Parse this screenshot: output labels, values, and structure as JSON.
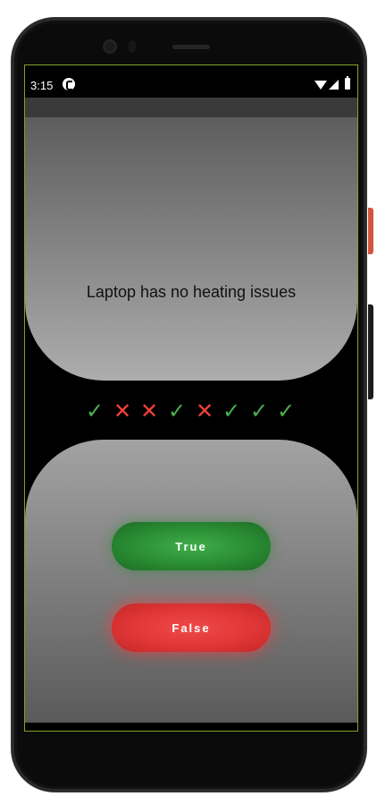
{
  "status_bar": {
    "time": "3:15"
  },
  "question": {
    "text": "Laptop has no heating issues"
  },
  "score_keeper": [
    "correct",
    "wrong",
    "wrong",
    "correct",
    "wrong",
    "correct",
    "correct",
    "correct"
  ],
  "score_glyphs": {
    "correct": "✓",
    "wrong": "✕"
  },
  "answers": {
    "true_label": "True",
    "false_label": "False"
  },
  "colors": {
    "correct": "#4caf50",
    "wrong": "#f44336",
    "true_button": "#2a8c33",
    "false_button": "#e03636",
    "screen_outline": "#7fa12a"
  },
  "icons": {
    "status_left": "app-notification-icon",
    "status_right": [
      "wifi-icon",
      "signal-icon",
      "battery-icon"
    ],
    "nav": [
      "back-icon",
      "home-icon",
      "recents-icon"
    ]
  }
}
